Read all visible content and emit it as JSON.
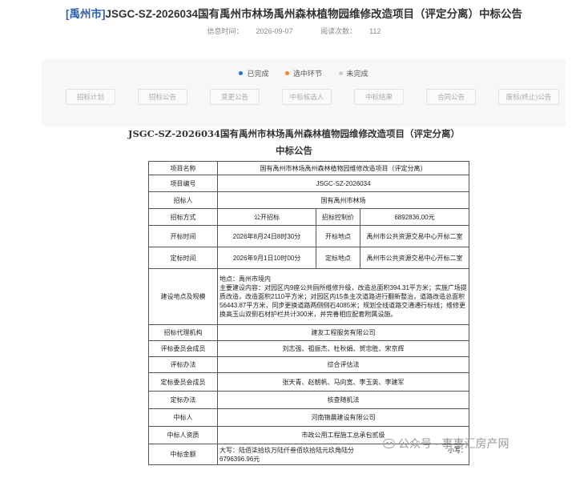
{
  "header": {
    "region": "[禹州市]",
    "title": "JSGC-SZ-2026034国有禹州市林场禹州森林植物园维修改造项目（评定分离）中标公告",
    "publish_time_label": "信息时间：",
    "publish_time": "2026-09-07",
    "read_count_label": "阅读次数：",
    "read_count": "112"
  },
  "progress": {
    "legend": [
      {
        "label": "已完成",
        "color": "#2b6fd6"
      },
      {
        "label": "选中环节",
        "color": "#f08a24"
      },
      {
        "label": "未完成",
        "color": "#cccccc"
      }
    ],
    "steps": [
      {
        "label": "招标计划"
      },
      {
        "label": "招标公告"
      },
      {
        "label": "变更公告"
      },
      {
        "label": "中标候选人"
      },
      {
        "label": "中标结果"
      },
      {
        "label": "合同公告"
      },
      {
        "label": "废标(终止)公告"
      }
    ]
  },
  "notice": {
    "title": "JSGC-SZ-2026034国有禹州市林场禹州森林植物园维修改造项目（评定分离）",
    "subtitle": "中标公告",
    "rows": {
      "project_name_label": "项目名称",
      "project_name": "国有禹州市林场禹州森林植物园维修改造项目（评定分离）",
      "project_no_label": "项目编号",
      "project_no": "JSGC-SZ-2026034",
      "tenderer_label": "招标人",
      "tenderer": "国有禹州市林场",
      "method_label": "招标方式",
      "method": "公开招标",
      "control_price_label": "招标控制价",
      "control_price": "6892836.00元",
      "open_time_label": "开标时间",
      "open_time": "2026年8月24日8时30分",
      "open_place_label": "开标地点",
      "open_place": "禹州市公共资源交易中心开标二室",
      "decide_time_label": "定标时间",
      "decide_time": "2026年9月1日10时00分",
      "decide_place_label": "定标地点",
      "decide_place": "禹州市公共资源交易中心开标二室",
      "scope_label": "建设地点及规模",
      "scope_location": "地点：禹州市境内",
      "scope_content": "主要建设内容：对园区内9座公共厕所维修升级，改造总面积394.31平方米；实施广场提质改造，改造面积2110平方米；对园区内15条主次道路进行翻新整治，道路改造总面积56443.87平方米，同步更换道路两侧侧石4085米；规划全线道路交通通行标线；维修更换高玉山双侧石材护栏共计300米，并完善相应配套附属设施。",
      "agency_label": "招标代理机构",
      "agency": "建友工程服务有限公司",
      "committee_label": "评标委员会成员",
      "committee": "刘志强、祖振杰、杜秋娟、贺忠胜、宋京辉",
      "eval_method_label": "评标办法",
      "eval_method": "综合评估法",
      "decide_committee_label": "定标委员会成员",
      "decide_committee": "张天青、赵朝帆、马向宽、李玉英、李建军",
      "decide_method_label": "定标办法",
      "decide_method": "核查随机法",
      "winner_label": "中标人",
      "winner": "河南锦晨建设有限公司",
      "qualification_label": "中标人资质",
      "qualification": "市政公用工程施工总承包贰级",
      "amount_label": "中标金额",
      "amount_upper": "大写：陆佰柒拾玖万陆仟叁佰玖拾陆元玖角陆分",
      "amount_lower_label": "小写：",
      "amount_lower": "6796396.96元"
    }
  },
  "watermark": {
    "text": "公众号 · 事事汇房产网"
  }
}
